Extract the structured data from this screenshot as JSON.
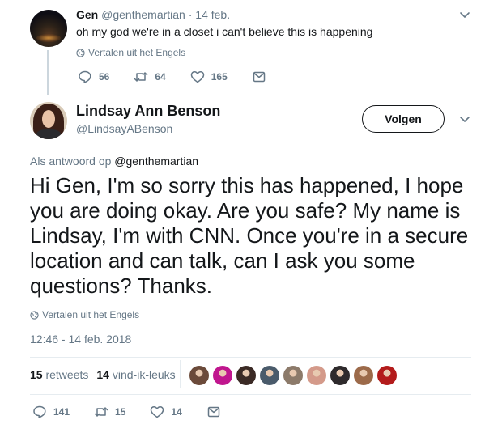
{
  "parent_tweet": {
    "name": "Gen",
    "handle": "@genthemartian",
    "separator": "·",
    "date": "14 feb.",
    "text": "oh my god we're in a closet i can't believe this is happening",
    "translate_label": "Vertalen uit het Engels",
    "replies": "56",
    "retweets": "64",
    "likes": "165"
  },
  "main_tweet": {
    "name": "Lindsay Ann Benson",
    "handle": "@LindsayABenson",
    "follow_label": "Volgen",
    "reply_prefix": "Als antwoord op",
    "reply_mention": "@genthemartian",
    "text": "Hi Gen, I'm so sorry this has happened, I hope you are doing okay. Are you safe? My name is Lindsay, I'm with CNN. Once you're in a secure location and can talk, can I ask you some questions? Thanks.",
    "translate_label": "Vertalen uit het Engels",
    "timestamp": "12:46 - 14 feb. 2018",
    "retweet_count": "15",
    "retweet_label": "retweets",
    "like_count": "14",
    "like_label": "vind-ik-leuks",
    "replies": "141",
    "retweets": "15",
    "likes": "14",
    "liker_avatar_colors": [
      "#6b4a3a",
      "#c0168e",
      "#3b2a25",
      "#4a5b6b",
      "#8c7a6a",
      "#d49a8a",
      "#2e2a2c",
      "#9c6a4a",
      "#b31b1b"
    ]
  },
  "colors": {
    "text_primary": "#14171a",
    "text_secondary": "#657786",
    "divider": "#e6ecf0"
  },
  "icons": [
    "chevron-down-icon",
    "globe-icon",
    "reply-icon",
    "retweet-icon",
    "heart-icon",
    "message-icon"
  ]
}
